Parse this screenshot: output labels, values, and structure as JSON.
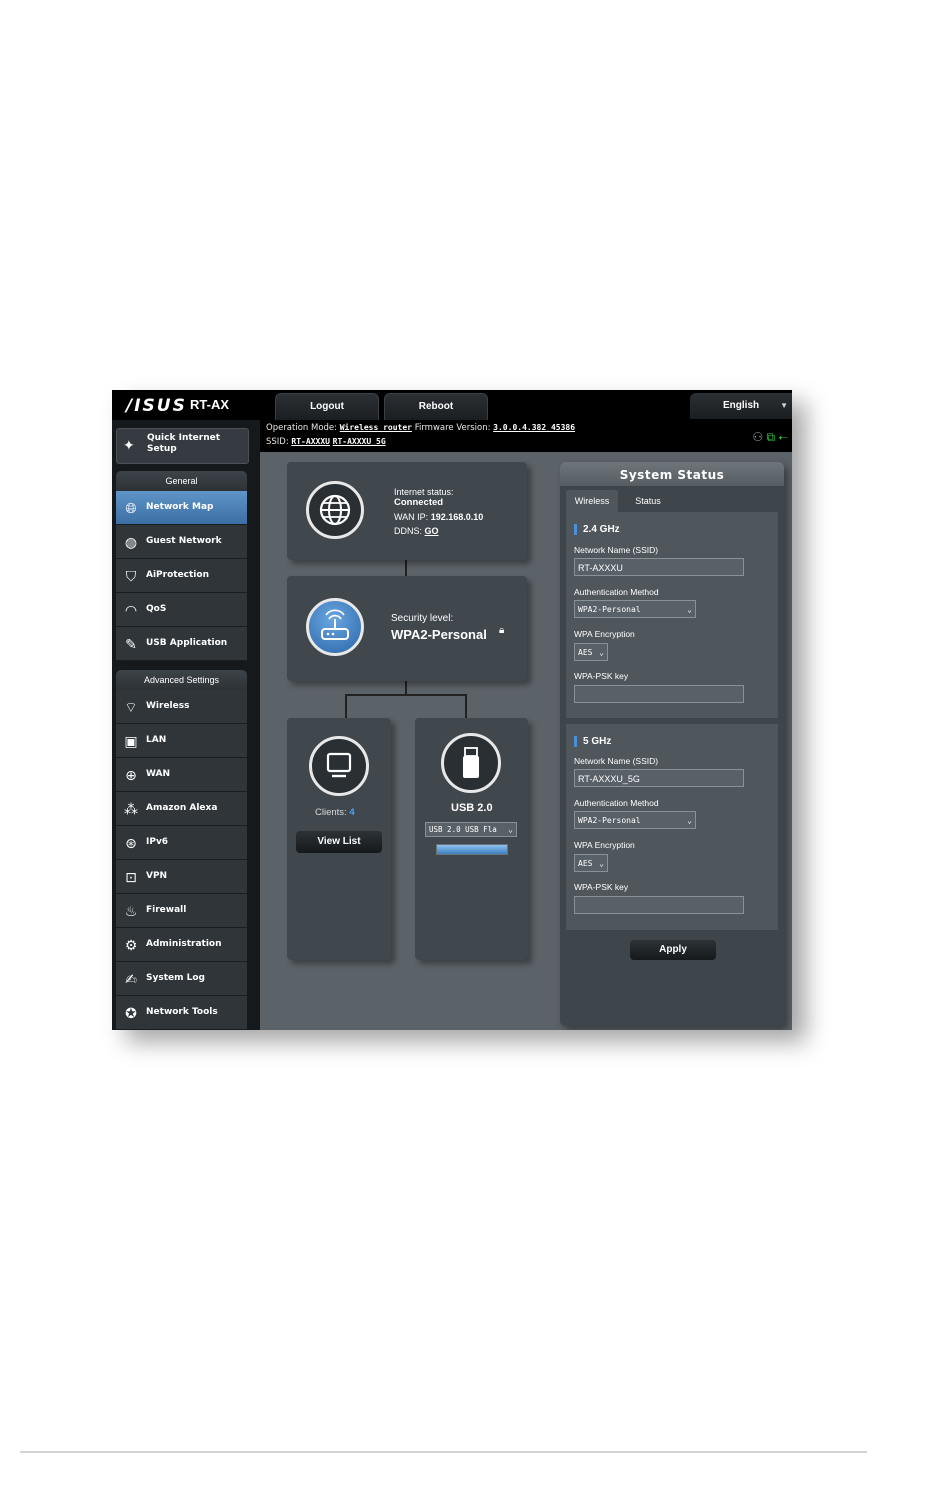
{
  "header": {
    "logo": "/ISUS",
    "model": "RT-AX",
    "logout_label": "Logout",
    "reboot_label": "Reboot",
    "language": "English"
  },
  "infobar": {
    "operation_mode_label": "Operation Mode:",
    "operation_mode_value": "Wireless router",
    "firmware_label": "Firmware Version:",
    "firmware_value": "3.0.0.4.382_45386",
    "ssid_label": "SSID:",
    "ssid_24": "RT-AXXXU",
    "ssid_5": "RT-AXXXU_5G"
  },
  "sidebar": {
    "quick_setup": "Quick Internet Setup",
    "general_header": "General",
    "general_items": [
      "Network Map",
      "Guest Network",
      "AiProtection",
      "QoS",
      "USB Application"
    ],
    "advanced_header": "Advanced Settings",
    "advanced_items": [
      "Wireless",
      "LAN",
      "WAN",
      "Amazon Alexa",
      "IPv6",
      "VPN",
      "Firewall",
      "Administration",
      "System Log",
      "Network Tools"
    ]
  },
  "map": {
    "internet_status_label": "Internet status:",
    "internet_status_value": "Connected",
    "wan_ip_label": "WAN IP:",
    "wan_ip_value": "192.168.0.10",
    "ddns_label": "DDNS:",
    "ddns_value": "GO",
    "security_label": "Security level:",
    "security_value": "WPA2-Personal",
    "clients_label": "Clients:",
    "clients_value": "4",
    "view_list": "View List",
    "usb_label": "USB 2.0",
    "usb_select": "USB 2.0 USB Fla"
  },
  "system_status": {
    "title": "System Status",
    "tab_wireless": "Wireless",
    "tab_status": "Status",
    "band_24": "2.4 GHz",
    "band_5": "5 GHz",
    "network_name_label": "Network Name (SSID)",
    "ssid_24": "RT-AXXXU",
    "ssid_5": "RT-AXXXU_5G",
    "auth_label": "Authentication Method",
    "auth_value": "WPA2-Personal",
    "enc_label": "WPA Encryption",
    "enc_value": "AES",
    "psk_label": "WPA-PSK key",
    "psk_24": "",
    "psk_5": "",
    "apply_label": "Apply"
  },
  "colors": {
    "accent_blue": "#3c6fa4",
    "band_marker": "#4a90d9",
    "clients_count": "#4aa3ff",
    "status_green": "#2ecc40"
  }
}
